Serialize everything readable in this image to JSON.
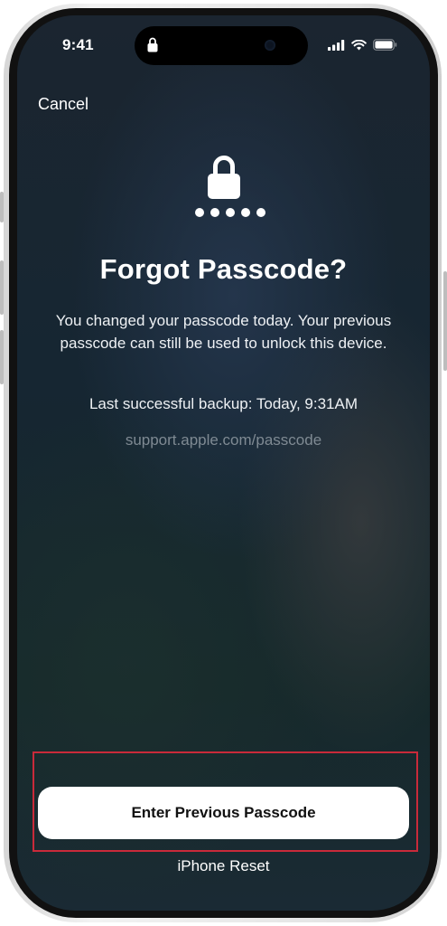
{
  "status_bar": {
    "time": "9:41",
    "icons": [
      "lock-icon",
      "signal-icon",
      "wifi-icon",
      "battery-icon"
    ]
  },
  "nav": {
    "cancel_label": "Cancel"
  },
  "header": {
    "icon": "lock-icon",
    "passcode_dots": 5,
    "title": "Forgot Passcode?"
  },
  "body": {
    "message": "You changed your passcode today. Your previous passcode can still be used to unlock this device.",
    "backup_text": "Last successful backup: Today, 9:31AM",
    "support_link": "support.apple.com/passcode"
  },
  "actions": {
    "primary_label": "Enter Previous Passcode",
    "secondary_label": "iPhone Reset"
  },
  "colors": {
    "highlight": "#c92a3a",
    "button_bg": "#ffffff",
    "link_gray": "#7f8a93"
  }
}
